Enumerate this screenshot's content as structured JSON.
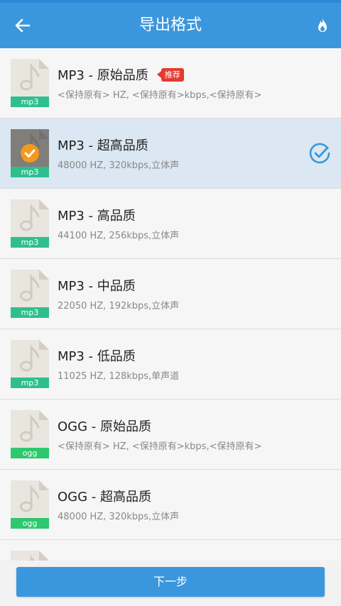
{
  "appbar": {
    "title": "导出格式",
    "back_icon": "arrow-left-icon",
    "action_icon": "flame-icon"
  },
  "colors": {
    "primary": "#3b97dd",
    "mp3_tag": "#2fbf8e",
    "ogg_tag": "#2dc76d",
    "badge": "#e63a2e",
    "check": "#f39a1e"
  },
  "items": [
    {
      "name": "MP3 - 原始品质",
      "desc": "<保持原有> HZ, <保持原有>kbps,<保持原有>",
      "ext": "mp3",
      "badge": "推荐",
      "selected": false
    },
    {
      "name": "MP3 - 超高品质",
      "desc": "48000 HZ, 320kbps,立体声",
      "ext": "mp3",
      "badge": "",
      "selected": true
    },
    {
      "name": "MP3 - 高品质",
      "desc": "44100 HZ, 256kbps,立体声",
      "ext": "mp3",
      "badge": "",
      "selected": false
    },
    {
      "name": "MP3 - 中品质",
      "desc": "22050 HZ, 192kbps,立体声",
      "ext": "mp3",
      "badge": "",
      "selected": false
    },
    {
      "name": "MP3 - 低品质",
      "desc": "11025 HZ, 128kbps,单声道",
      "ext": "mp3",
      "badge": "",
      "selected": false
    },
    {
      "name": "OGG - 原始品质",
      "desc": "<保持原有> HZ, <保持原有>kbps,<保持原有>",
      "ext": "ogg",
      "badge": "",
      "selected": false
    },
    {
      "name": "OGG - 超高品质",
      "desc": "48000 HZ, 320kbps,立体声",
      "ext": "ogg",
      "badge": "",
      "selected": false
    }
  ],
  "footer": {
    "next_label": "下一步"
  }
}
